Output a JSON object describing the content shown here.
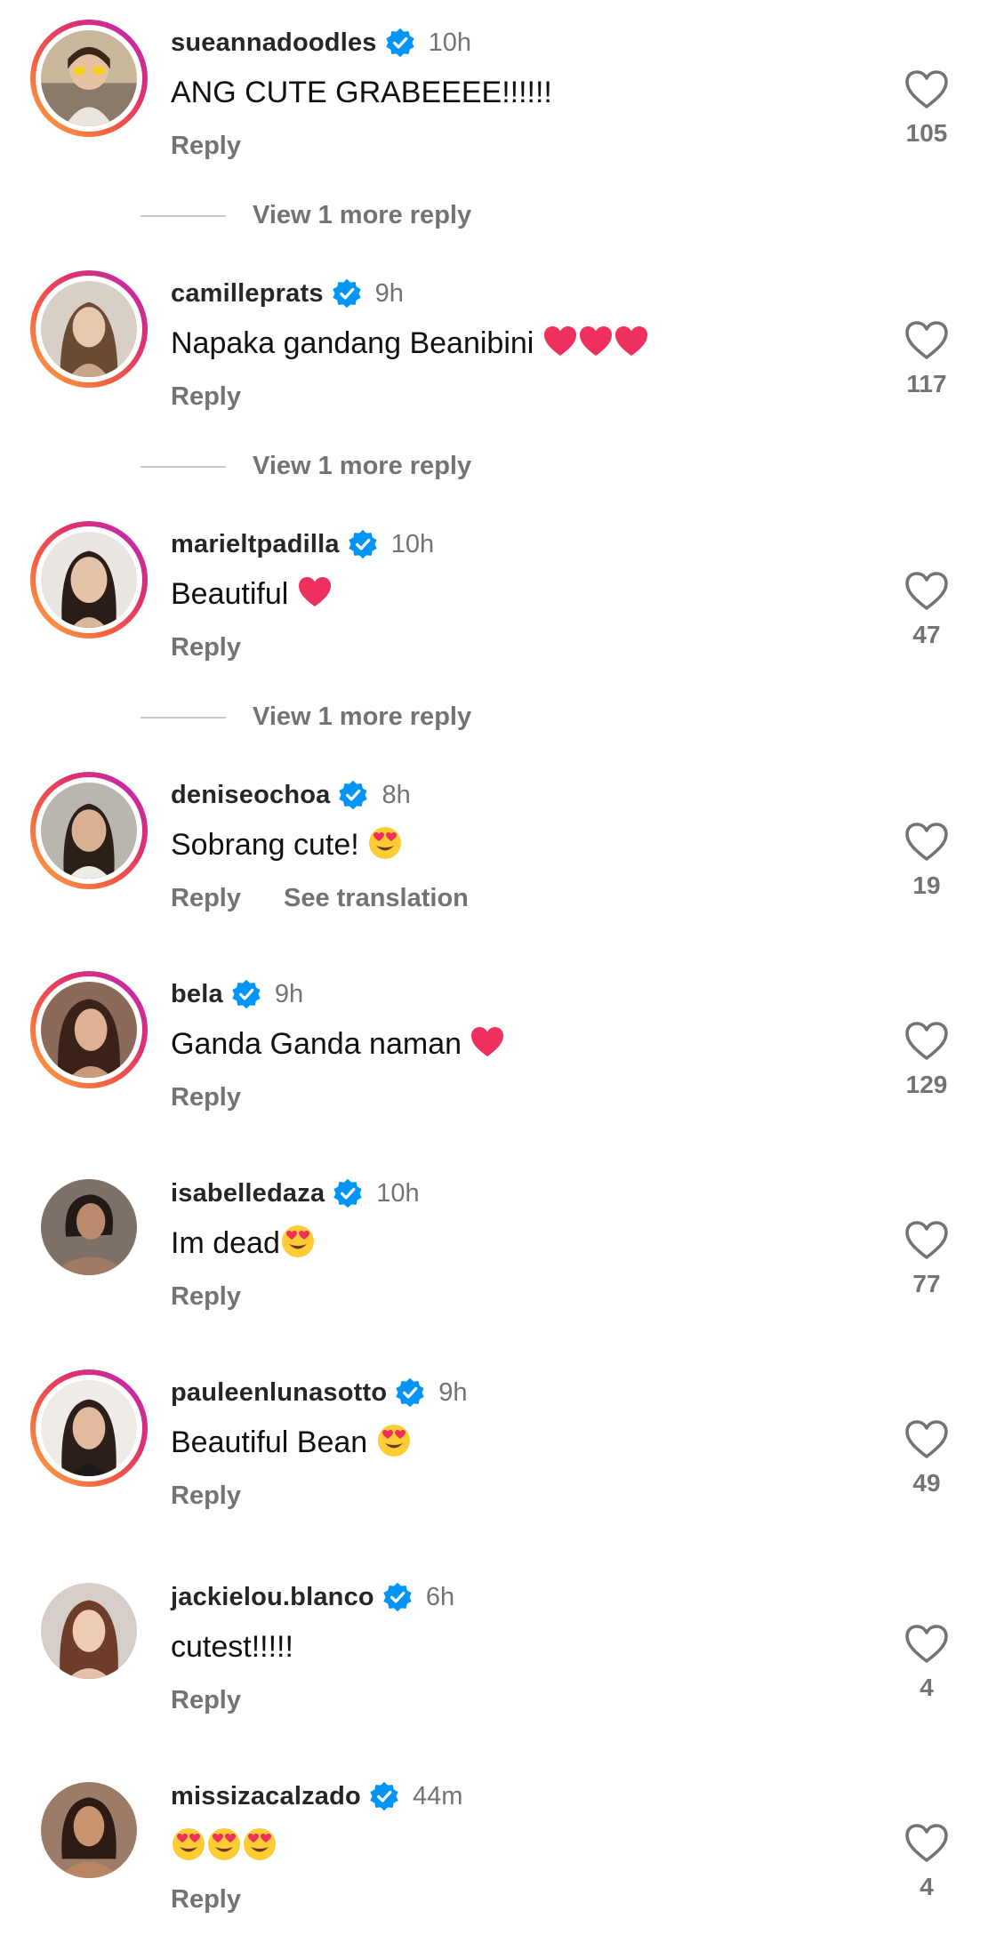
{
  "comments": [
    {
      "username": "sueannadoodles",
      "time": "10h",
      "text": "ANG CUTE GRABEEEE!!!!!!",
      "emojis": [],
      "reply_label": "Reply",
      "likes": "105",
      "view_more": "View 1 more reply",
      "story_ring": true
    },
    {
      "username": "camilleprats",
      "time": "9h",
      "text": "Napaka gandang Beanibini ",
      "emojis": [
        "heart",
        "heart",
        "heart"
      ],
      "reply_label": "Reply",
      "likes": "117",
      "view_more": "View 1 more reply",
      "story_ring": true
    },
    {
      "username": "marieltpadilla",
      "time": "10h",
      "text": "Beautiful ",
      "emojis": [
        "heart"
      ],
      "reply_label": "Reply",
      "likes": "47",
      "view_more": "View 1 more reply",
      "story_ring": true
    },
    {
      "username": "deniseochoa",
      "time": "8h",
      "text": "Sobrang cute! ",
      "emojis": [
        "heart-eyes"
      ],
      "reply_label": "Reply",
      "see_translation": "See translation",
      "likes": "19",
      "story_ring": true
    },
    {
      "username": "bela",
      "time": "9h",
      "text": "Ganda Ganda naman ",
      "emojis": [
        "heart"
      ],
      "reply_label": "Reply",
      "likes": "129",
      "story_ring": true
    },
    {
      "username": "isabelledaza",
      "time": "10h",
      "text": "Im dead",
      "emojis": [
        "heart-eyes"
      ],
      "reply_label": "Reply",
      "likes": "77",
      "story_ring": false
    },
    {
      "username": "pauleenlunasotto",
      "time": "9h",
      "text": "Beautiful Bean ",
      "emojis": [
        "heart-eyes"
      ],
      "reply_label": "Reply",
      "likes": "49",
      "story_ring": true
    },
    {
      "username": "jackielou.blanco",
      "time": "6h",
      "text": "cutest!!!!!",
      "emojis": [],
      "reply_label": "Reply",
      "likes": "4",
      "story_ring": false
    },
    {
      "username": "missizacalzado",
      "time": "44m",
      "text": "",
      "emojis": [
        "heart-eyes",
        "heart-eyes",
        "heart-eyes"
      ],
      "reply_label": "Reply",
      "likes": "4",
      "story_ring": false
    }
  ],
  "colors": {
    "verified": "#0095f6",
    "heart_emoji": "#ef2f5e",
    "secondary_text": "#737373"
  },
  "icons": {
    "verified": "verified-badge-icon",
    "like": "heart-outline-icon"
  }
}
